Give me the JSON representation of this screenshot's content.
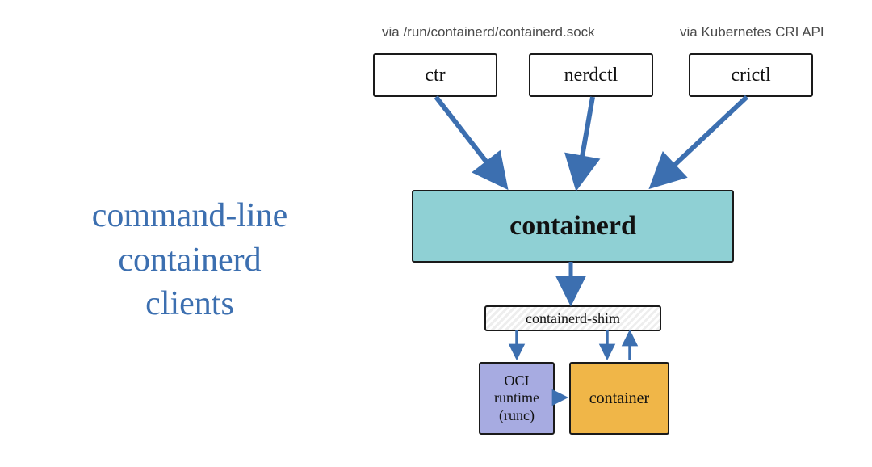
{
  "title_lines": {
    "l1": "command-line",
    "l2": "containerd",
    "l3": "clients"
  },
  "captions": {
    "sock": "via /run/containerd/containerd.sock",
    "cri": "via Kubernetes CRI API"
  },
  "clients": {
    "ctr": "ctr",
    "nerdctl": "nerdctl",
    "crictl": "crictl"
  },
  "core": {
    "containerd": "containerd",
    "shim": "containerd-shim",
    "oci": "OCI\nruntime\n(runc)",
    "container": "container"
  },
  "colors": {
    "arrow": "#3c6fb0",
    "title": "#3c6fb0",
    "containerd_bg": "#8fd0d4",
    "oci_bg": "#a7abe1",
    "container_bg": "#f0b648"
  },
  "chart_data": {
    "type": "flow-diagram",
    "nodes": [
      {
        "id": "ctr",
        "label": "ctr",
        "kind": "cli-client"
      },
      {
        "id": "nerdctl",
        "label": "nerdctl",
        "kind": "cli-client"
      },
      {
        "id": "crictl",
        "label": "crictl",
        "kind": "cli-client"
      },
      {
        "id": "containerd",
        "label": "containerd",
        "kind": "daemon"
      },
      {
        "id": "shim",
        "label": "containerd-shim",
        "kind": "shim"
      },
      {
        "id": "oci",
        "label": "OCI runtime (runc)",
        "kind": "runtime"
      },
      {
        "id": "container",
        "label": "container",
        "kind": "container"
      }
    ],
    "edges": [
      {
        "from": "ctr",
        "to": "containerd",
        "via": "/run/containerd/containerd.sock"
      },
      {
        "from": "nerdctl",
        "to": "containerd",
        "via": "/run/containerd/containerd.sock"
      },
      {
        "from": "crictl",
        "to": "containerd",
        "via": "Kubernetes CRI API"
      },
      {
        "from": "containerd",
        "to": "shim"
      },
      {
        "from": "shim",
        "to": "oci"
      },
      {
        "from": "shim",
        "to": "container",
        "bidirectional": true
      },
      {
        "from": "oci",
        "to": "container"
      }
    ],
    "annotations": [
      {
        "text": "via /run/containerd/containerd.sock",
        "applies_to": [
          "ctr",
          "nerdctl"
        ]
      },
      {
        "text": "via Kubernetes CRI API",
        "applies_to": [
          "crictl"
        ]
      }
    ]
  }
}
